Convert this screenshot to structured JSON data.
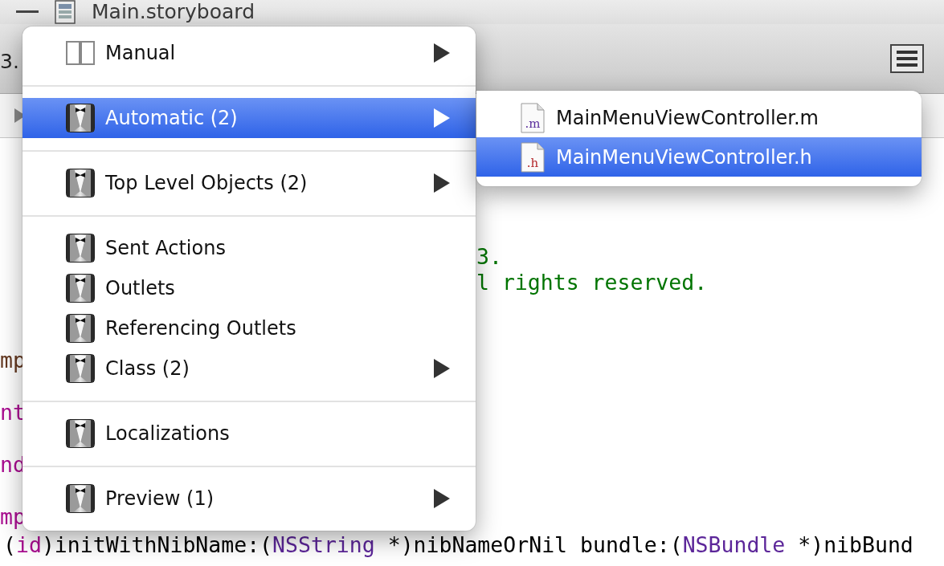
{
  "window": {
    "title": "Main.storyboard"
  },
  "toolbar": {
    "tab_fragment": "3."
  },
  "code_lines": [
    {
      "segments": [
        {
          "text": "3.",
          "kind": "comment"
        }
      ]
    },
    {
      "segments": [
        {
          "text": "l rights reserved.",
          "kind": "comment"
        }
      ]
    },
    {
      "segments": [
        {
          "text": "mp",
          "kind": "preprocessor"
        }
      ]
    },
    {
      "segments": [
        {
          "text": "nt",
          "kind": "keyword"
        }
      ]
    },
    {
      "segments": [
        {
          "text": "nd",
          "kind": "keyword"
        }
      ]
    },
    {
      "segments": [
        {
          "text": "mp",
          "kind": "keyword"
        }
      ]
    },
    {
      "segments": [
        {
          "text": "(",
          "kind": "plain"
        },
        {
          "text": "id",
          "kind": "keyword"
        },
        {
          "text": ")initWithNibName:(",
          "kind": "plain"
        },
        {
          "text": "NSString",
          "kind": "type"
        },
        {
          "text": " *)nibNameOrNil bundle:(",
          "kind": "plain"
        },
        {
          "text": "NSBundle",
          "kind": "type"
        },
        {
          "text": " *)nibBund",
          "kind": "plain"
        }
      ]
    }
  ],
  "menu": {
    "groups": [
      [
        {
          "label": "Manual",
          "kind": "split",
          "submenu": true,
          "selected": false
        }
      ],
      [
        {
          "label": "Automatic (2)",
          "kind": "object",
          "submenu": true,
          "selected": true
        }
      ],
      [
        {
          "label": "Top Level Objects (2)",
          "kind": "object",
          "submenu": true,
          "selected": false
        }
      ],
      [
        {
          "label": "Sent Actions",
          "kind": "object",
          "submenu": false,
          "selected": false
        },
        {
          "label": "Outlets",
          "kind": "object",
          "submenu": false,
          "selected": false
        },
        {
          "label": "Referencing Outlets",
          "kind": "object",
          "submenu": false,
          "selected": false
        },
        {
          "label": "Class (2)",
          "kind": "object",
          "submenu": true,
          "selected": false
        }
      ],
      [
        {
          "label": "Localizations",
          "kind": "object",
          "submenu": false,
          "selected": false
        }
      ],
      [
        {
          "label": "Preview (1)",
          "kind": "object",
          "submenu": true,
          "selected": false
        }
      ]
    ]
  },
  "submenu": {
    "items": [
      {
        "label": "MainMenuViewController.m",
        "badge": ".m",
        "kind": "implementation",
        "selected": false
      },
      {
        "label": "MainMenuViewController.h",
        "badge": ".h",
        "kind": "header",
        "selected": true
      }
    ]
  }
}
